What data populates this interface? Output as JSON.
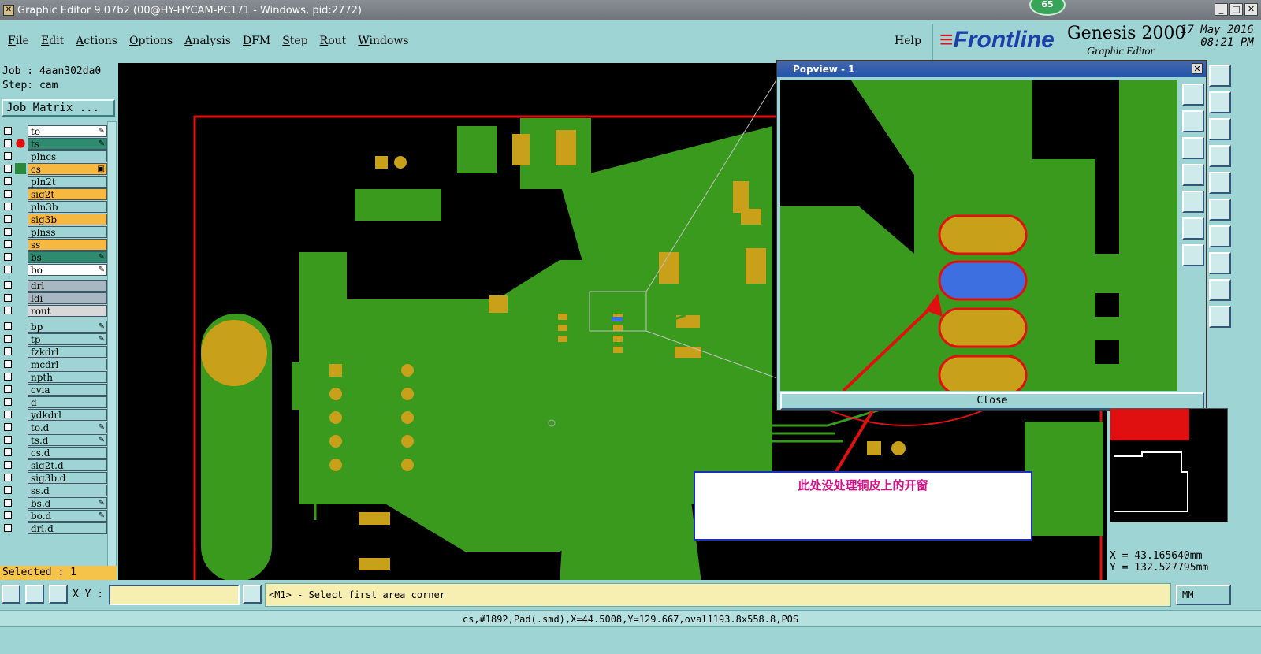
{
  "window": {
    "title": "Graphic Editor 9.07b2 (00@HY-HYCAM-PC171 - Windows, pid:2772)",
    "badge": "65"
  },
  "menu": [
    "File",
    "Edit",
    "Actions",
    "Options",
    "Analysis",
    "DFM",
    "Step",
    "Rout",
    "Windows"
  ],
  "help": "Help",
  "logo": {
    "brand": "Frontline",
    "product": "Genesis 2000",
    "subtitle": "Graphic Editor",
    "date": "17 May 2016",
    "time": "08:21 PM"
  },
  "job": {
    "job": "Job : 4aan302da0",
    "step": "Step: cam",
    "matrix_button": "Job Matrix ..."
  },
  "layers": [
    {
      "name": "to",
      "color": "#ffffff",
      "mark": "✎"
    },
    {
      "name": "ts",
      "color": "#2e8b70",
      "mark": "✎"
    },
    {
      "name": "plncs",
      "color": "#9ed4d4",
      "mark": ""
    },
    {
      "name": "cs",
      "color": "#f6b841",
      "mark": "▣"
    },
    {
      "name": "pln2t",
      "color": "#9ed4d4",
      "mark": ""
    },
    {
      "name": "sig2t",
      "color": "#f6b841",
      "mark": ""
    },
    {
      "name": "pln3b",
      "color": "#9ed4d4",
      "mark": ""
    },
    {
      "name": "sig3b",
      "color": "#f6b841",
      "mark": ""
    },
    {
      "name": "plnss",
      "color": "#9ed4d4",
      "mark": ""
    },
    {
      "name": "ss",
      "color": "#f6b841",
      "mark": ""
    },
    {
      "name": "bs",
      "color": "#2e8b70",
      "mark": "✎"
    },
    {
      "name": "bo",
      "color": "#ffffff",
      "mark": "✎"
    },
    {
      "name": "drl",
      "color": "#a7b8c2",
      "mark": ""
    },
    {
      "name": "ldi",
      "color": "#a7b8c2",
      "mark": ""
    },
    {
      "name": "rout",
      "color": "#d8d8d8",
      "mark": ""
    },
    {
      "name": "bp",
      "color": "#9ed4d4",
      "mark": "✎"
    },
    {
      "name": "tp",
      "color": "#9ed4d4",
      "mark": "✎"
    },
    {
      "name": "fzkdrl",
      "color": "#9ed4d4",
      "mark": ""
    },
    {
      "name": "mcdrl",
      "color": "#9ed4d4",
      "mark": ""
    },
    {
      "name": "npth",
      "color": "#9ed4d4",
      "mark": ""
    },
    {
      "name": "cvia",
      "color": "#9ed4d4",
      "mark": ""
    },
    {
      "name": "d",
      "color": "#9ed4d4",
      "mark": ""
    },
    {
      "name": "ydkdrl",
      "color": "#9ed4d4",
      "mark": ""
    },
    {
      "name": "to.d",
      "color": "#9ed4d4",
      "mark": "✎"
    },
    {
      "name": "ts.d",
      "color": "#9ed4d4",
      "mark": "✎"
    },
    {
      "name": "cs.d",
      "color": "#9ed4d4",
      "mark": ""
    },
    {
      "name": "sig2t.d",
      "color": "#9ed4d4",
      "mark": ""
    },
    {
      "name": "sig3b.d",
      "color": "#9ed4d4",
      "mark": ""
    },
    {
      "name": "ss.d",
      "color": "#9ed4d4",
      "mark": ""
    },
    {
      "name": "bs.d",
      "color": "#9ed4d4",
      "mark": "✎"
    },
    {
      "name": "bo.d",
      "color": "#9ed4d4",
      "mark": "✎"
    },
    {
      "name": "drl.d",
      "color": "#9ed4d4",
      "mark": ""
    }
  ],
  "selected": "Selected : 1",
  "popview": {
    "title": "Popview - 1",
    "close": "Close"
  },
  "note": "此处没处理铜皮上的开窗",
  "coords": {
    "x": "X  =  43.165640mm",
    "y": "Y  = 132.527795mm"
  },
  "xy_label": "X Y :",
  "xy_value": "",
  "prompt": "<M1> - Select first area corner",
  "unit": "MM",
  "status": "cs,#1892,Pad(.smd),X=44.5008,Y=129.667,oval1193.8x558.8,POS",
  "colors": {
    "copper": "#3a9a1e",
    "pad": "#c8a01a",
    "board_outline": "#e01010",
    "highlight": "#3d6fe0"
  }
}
